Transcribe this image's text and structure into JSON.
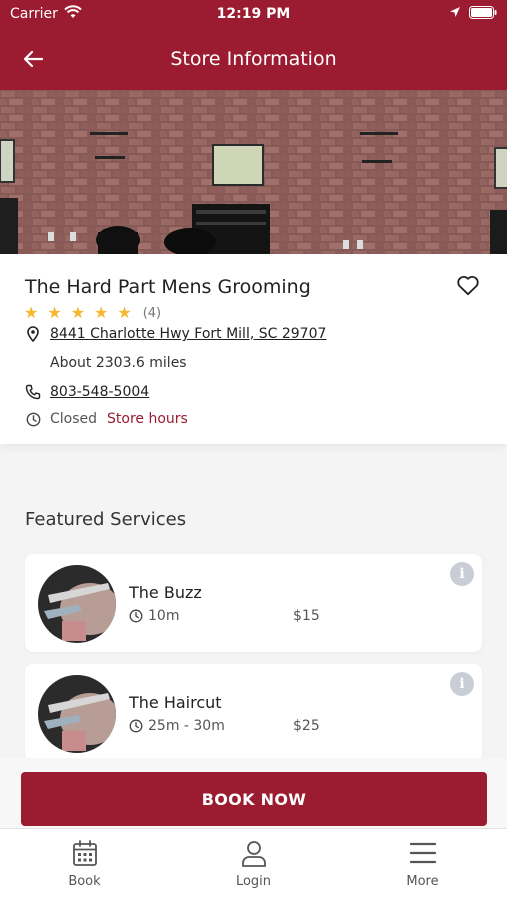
{
  "status_bar": {
    "carrier": "Carrier",
    "time": "12:19 PM"
  },
  "nav": {
    "title": "Store Information"
  },
  "store": {
    "name": "The Hard Part Mens Grooming",
    "rating_stars": 5,
    "rating_count": "(4)",
    "address": "8441 Charlotte Hwy Fort Mill, SC 29707",
    "distance": "About 2303.6 miles",
    "phone": "803-548-5004",
    "status": "Closed",
    "hours_link": "Store hours"
  },
  "featured": {
    "title": "Featured Services",
    "services": [
      {
        "name": "The Buzz",
        "duration": "10m",
        "price": "$15"
      },
      {
        "name": "The Haircut",
        "duration": "25m - 30m",
        "price": "$25"
      }
    ]
  },
  "actions": {
    "book_label": "BOOK NOW"
  },
  "tabs": [
    {
      "label": "Book",
      "icon": "calendar-icon"
    },
    {
      "label": "Login",
      "icon": "user-icon"
    },
    {
      "label": "More",
      "icon": "menu-icon"
    }
  ],
  "colors": {
    "brand": "#9b1b30",
    "star": "#f5b82e",
    "info": "#c9ced6"
  }
}
